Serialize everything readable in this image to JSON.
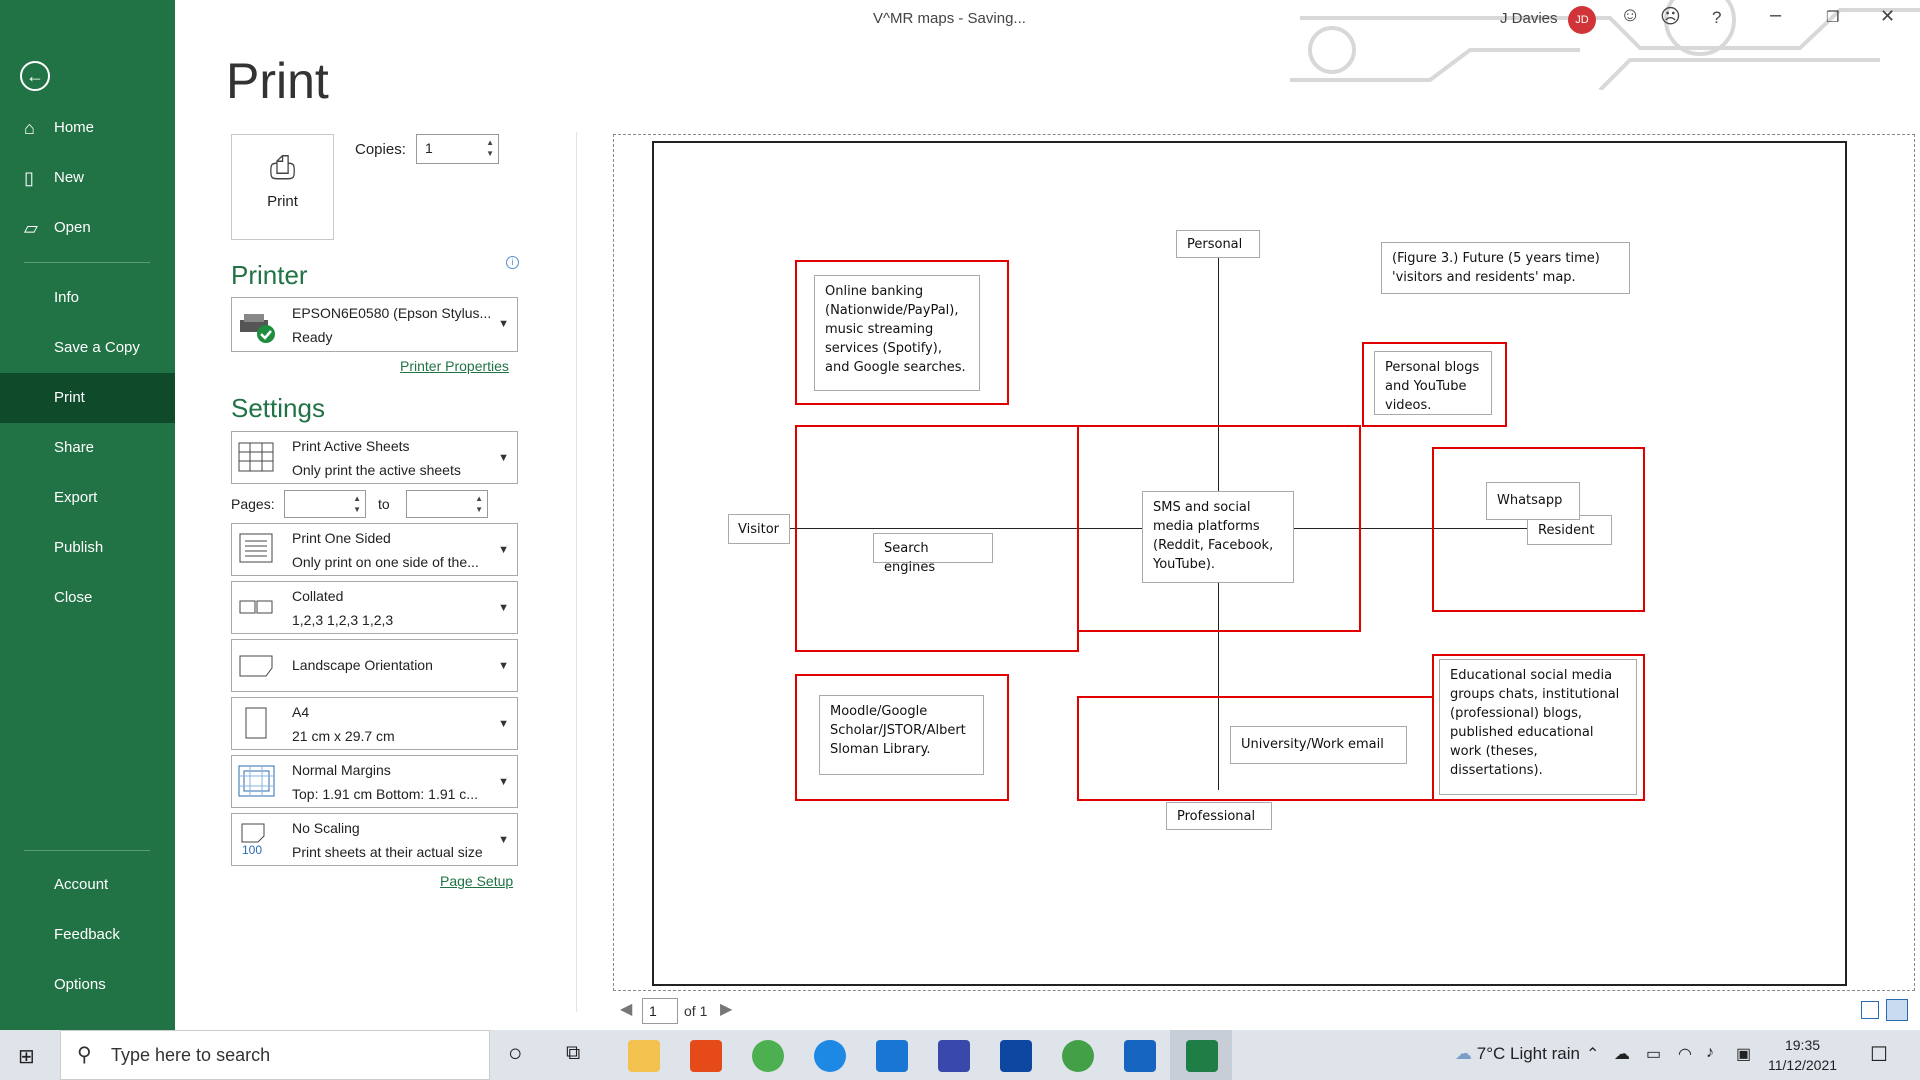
{
  "window": {
    "title": "V^MR maps  -  Saving...",
    "user": "J Davies",
    "avatar_initials": "JD"
  },
  "nav": {
    "top": [
      "Home",
      "New",
      "Open"
    ],
    "middle": [
      "Info",
      "Save a Copy",
      "Print",
      "Share",
      "Export",
      "Publish",
      "Close"
    ],
    "bottom": [
      "Account",
      "Feedback",
      "Options"
    ],
    "selected": "Print"
  },
  "print": {
    "title": "Print",
    "button": "Print",
    "copies_label": "Copies:",
    "copies_value": "1",
    "printer_heading": "Printer",
    "printer_name": "EPSON6E0580 (Epson Stylus...",
    "printer_status": "Ready",
    "printer_properties": "Printer Properties",
    "settings_heading": "Settings",
    "settings": [
      {
        "l1": "Print Active Sheets",
        "l2": "Only print the active sheets"
      },
      {
        "l1": "Print One Sided",
        "l2": "Only print on one side of the..."
      },
      {
        "l1": "Collated",
        "l2": "1,2,3    1,2,3    1,2,3"
      },
      {
        "l1": "Landscape Orientation",
        "l2": ""
      },
      {
        "l1": "A4",
        "l2": "21 cm x 29.7 cm"
      },
      {
        "l1": "Normal Margins",
        "l2": "Top: 1.91 cm Bottom: 1.91 c..."
      },
      {
        "l1": "No Scaling",
        "l2": "Print sheets at their actual size"
      }
    ],
    "pages_label": "Pages:",
    "to_label": "to",
    "page_setup": "Page Setup",
    "scale_icon_text": "100"
  },
  "preview": {
    "axis": {
      "top": "Personal",
      "bottom": "Professional",
      "left": "Visitor",
      "right": "Resident"
    },
    "boxes": {
      "online_banking": "Online banking (Nationwide/PayPal), music streaming services (Spotify), and Google searches.",
      "figure_caption": "(Figure 3.) Future (5 years time) 'visitors and residents' map.",
      "personal_blogs": "Personal blogs and YouTube videos.",
      "search_engines": "Search engines",
      "sms_social": "SMS and social media platforms (Reddit, Facebook, YouTube).",
      "whatsapp": "Whatsapp",
      "moodle": "Moodle/Google Scholar/JSTOR/Albert Sloman Library.",
      "work_email": "University/Work email",
      "educational": "Educational social media groups chats, institutional (professional) blogs, published educational work (theses, dissertations)."
    },
    "page_number": "1",
    "page_of": "of 1"
  },
  "taskbar": {
    "search_placeholder": "Type here to search",
    "weather": "7°C  Light rain",
    "time": "19:35",
    "date": "11/12/2021"
  }
}
